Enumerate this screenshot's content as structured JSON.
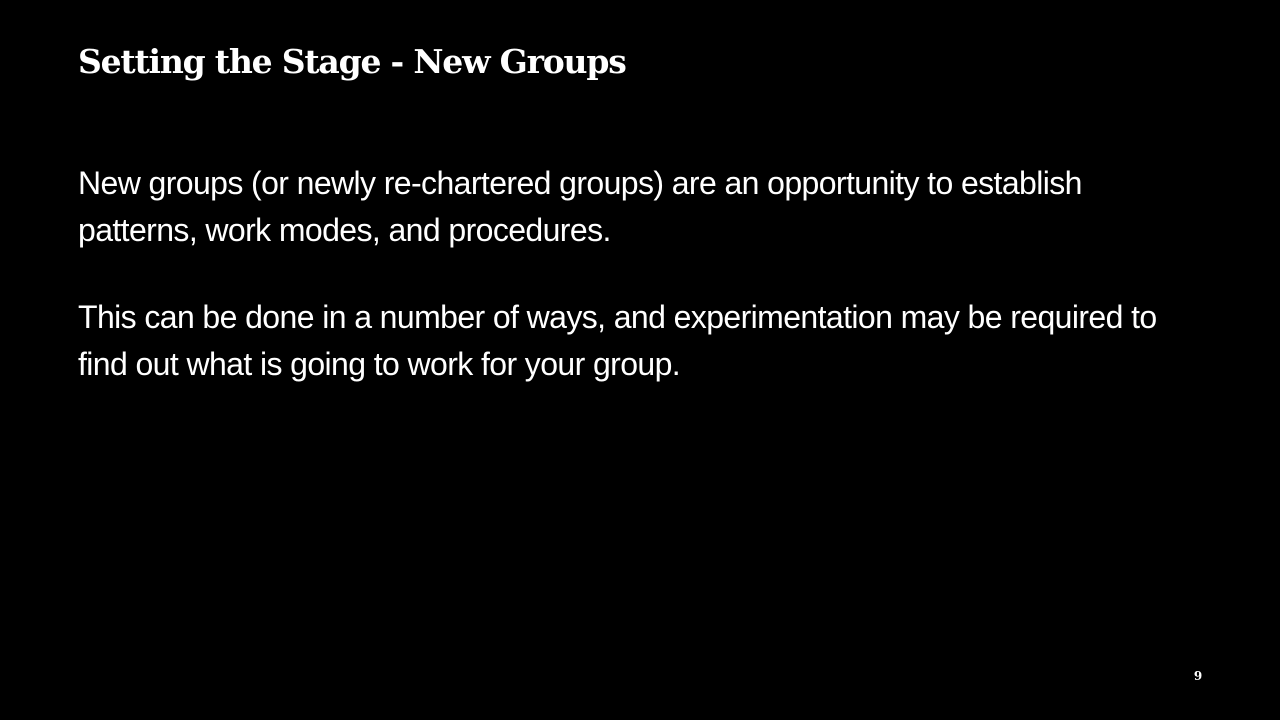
{
  "slide": {
    "title": "Setting the Stage - New Groups",
    "paragraphs": [
      "New groups (or newly re-chartered groups) are an opportunity to establish patterns, work modes, and procedures.",
      "This can be done in a number of ways, and experimentation may be required to find out what is going to work for your group."
    ],
    "page_number": "9"
  },
  "colors": {
    "background": "#000000",
    "text": "#ffffff"
  }
}
